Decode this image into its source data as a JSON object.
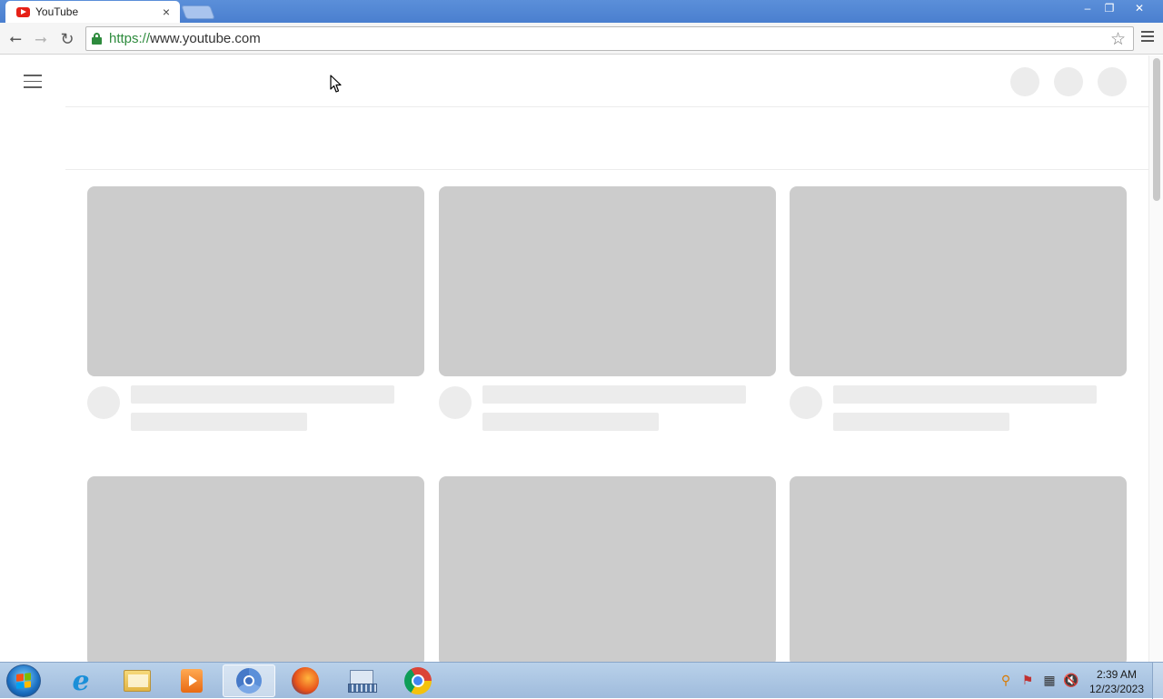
{
  "browser": {
    "tab_title": "YouTube",
    "tab_close_glyph": "×",
    "url_scheme": "https://",
    "url_host": "www.youtube.com",
    "window_controls": {
      "minimize": "‒",
      "maximize": "❐",
      "close": "✕"
    },
    "nav_glyphs": {
      "back": "⭠",
      "forward": "⭢",
      "reload": "↻",
      "star": "☆"
    },
    "accent_color": "#2e8b3d"
  },
  "page": {
    "skeleton_color_thumb": "#cccccc",
    "skeleton_color_line": "#ececec",
    "grid_rows": [
      [
        "video-placeholder",
        "video-placeholder",
        "video-placeholder"
      ],
      [
        "video-placeholder",
        "video-placeholder",
        "video-placeholder"
      ]
    ]
  },
  "taskbar": {
    "pinned_apps": [
      "internet-explorer",
      "windows-explorer",
      "media-player",
      "chromium",
      "firefox",
      "on-screen-keyboard",
      "google-chrome"
    ],
    "active_app": "chromium",
    "clock_time": "2:39 AM",
    "clock_date": "12/23/2023"
  }
}
